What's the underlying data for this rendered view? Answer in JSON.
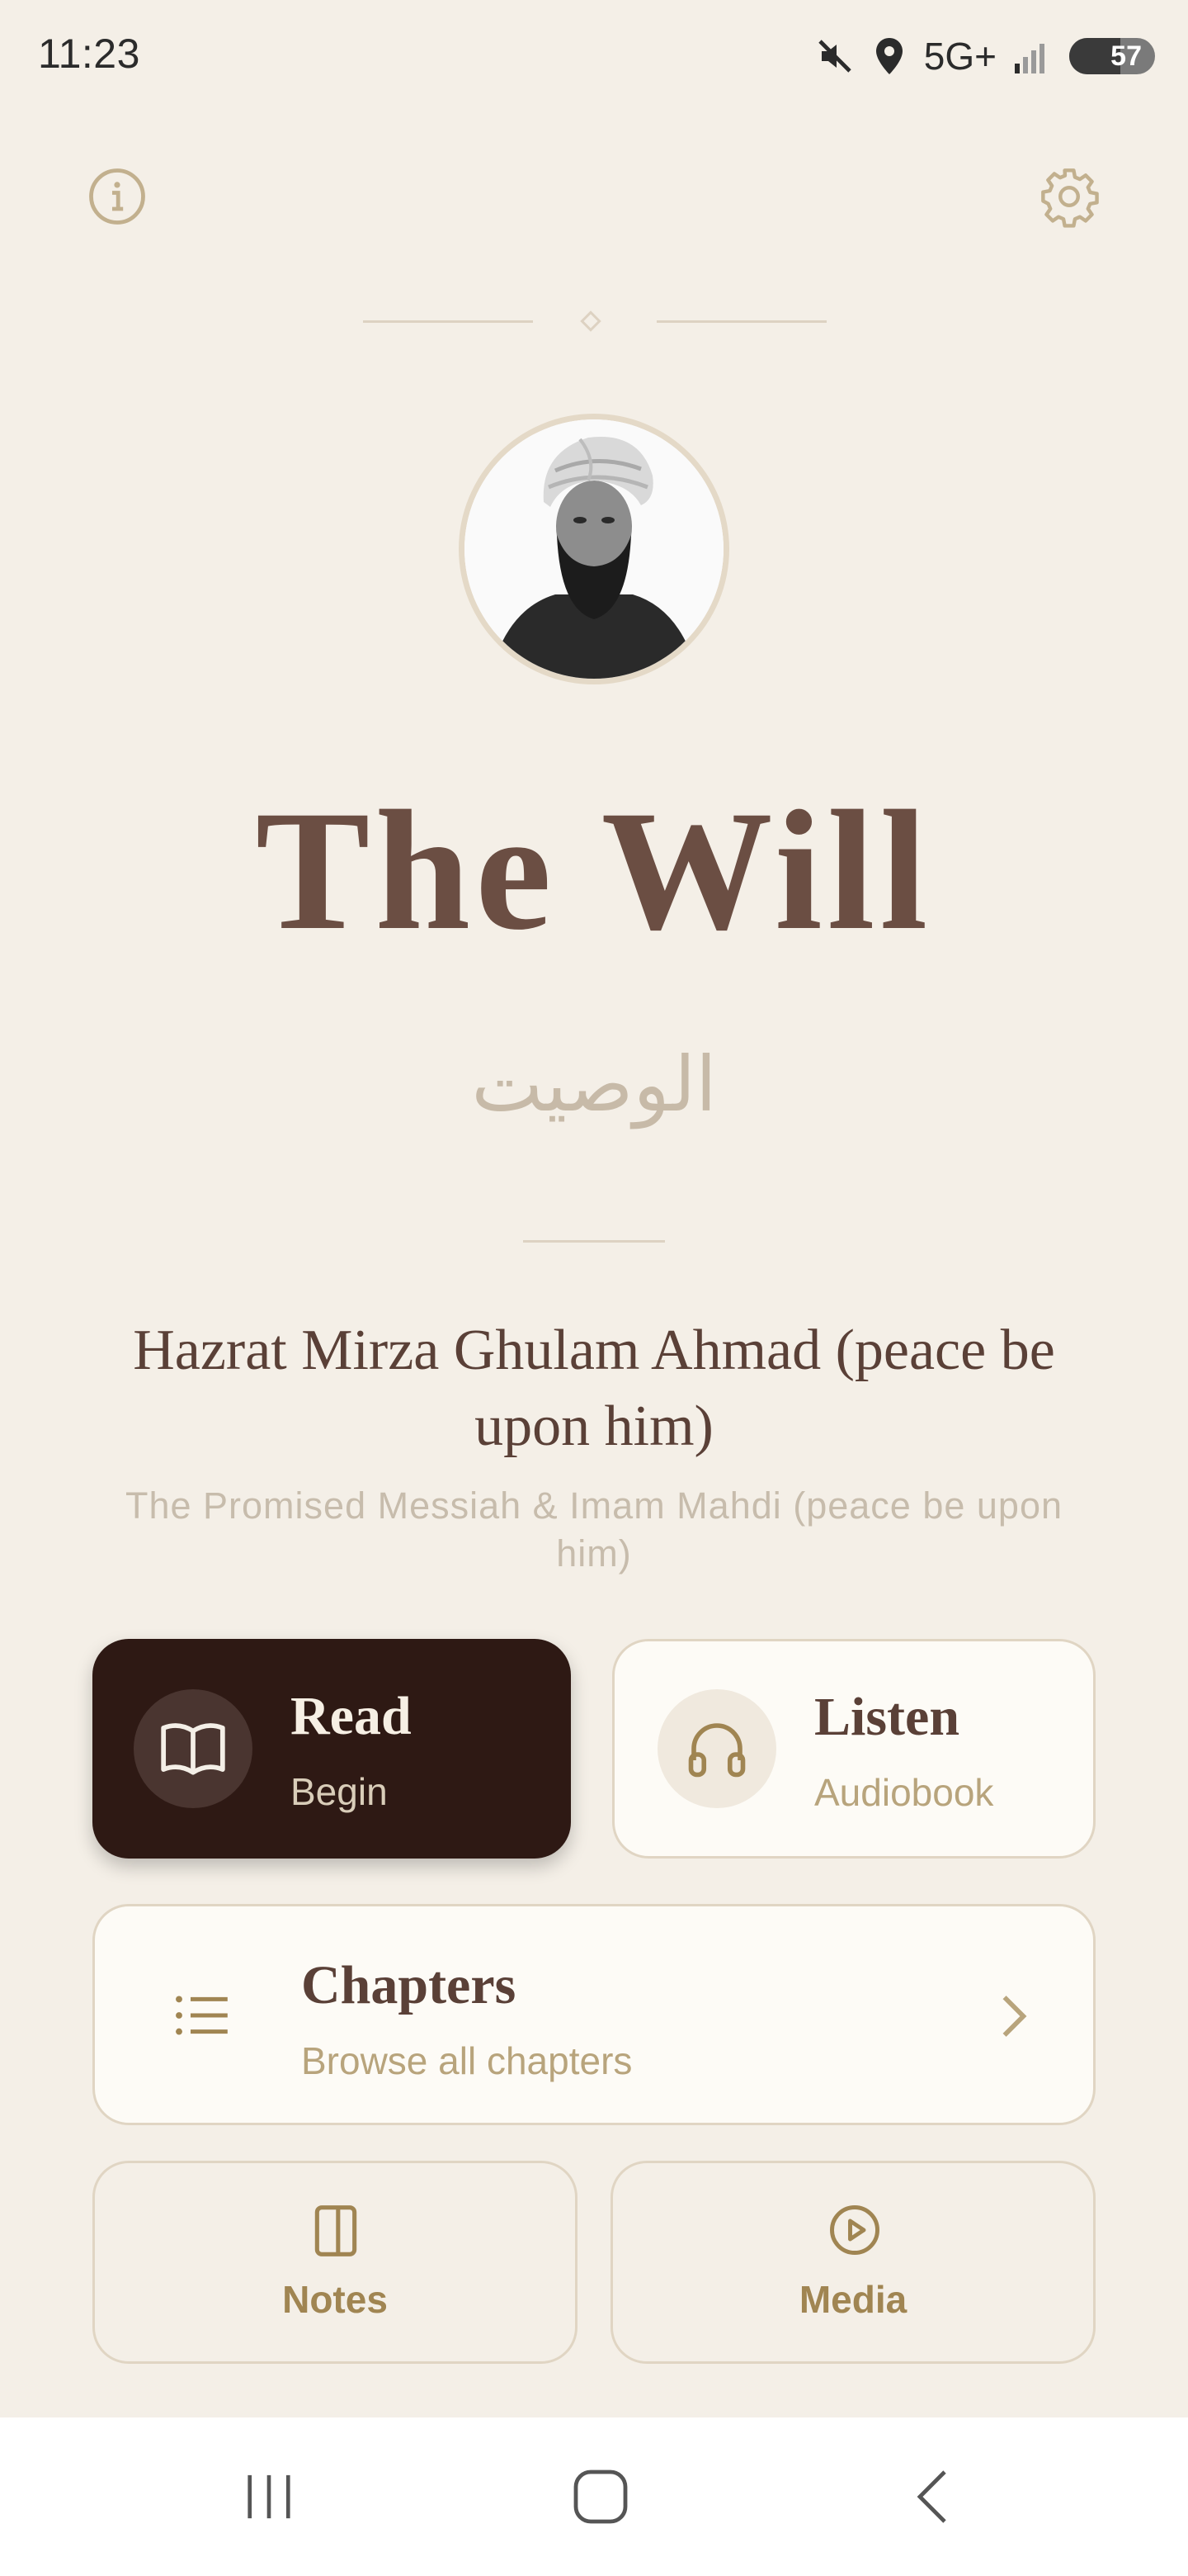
{
  "status_bar": {
    "time": "11:23",
    "network": "5G+",
    "battery": "57",
    "icons": [
      "mute-icon",
      "location-icon",
      "signal-icon",
      "battery-icon"
    ]
  },
  "header": {
    "info_icon": "info-icon",
    "settings_icon": "gear-icon"
  },
  "book": {
    "title": "The Will",
    "arabic_title": "الوصیت",
    "author": "Hazrat Mirza Ghulam Ahmad (peace be upon him)",
    "author_subtitle": "The Promised Messiah & Imam Mahdi (peace be upon him)"
  },
  "actions": {
    "read": {
      "title": "Read",
      "subtitle": "Begin",
      "icon": "book-open-icon"
    },
    "listen": {
      "title": "Listen",
      "subtitle": "Audiobook",
      "icon": "headphones-icon"
    },
    "chapters": {
      "title": "Chapters",
      "subtitle": "Browse all chapters",
      "icon": "list-icon"
    },
    "notes": {
      "label": "Notes",
      "icon": "notes-icon"
    },
    "media": {
      "label": "Media",
      "icon": "play-circle-icon"
    }
  },
  "colors": {
    "background": "#f4efe7",
    "primary_dark": "#2e1914",
    "accent_gold": "#a08552",
    "title_brown": "#6b4e43"
  },
  "nav_bar": {
    "buttons": [
      "recents",
      "home",
      "back"
    ]
  }
}
